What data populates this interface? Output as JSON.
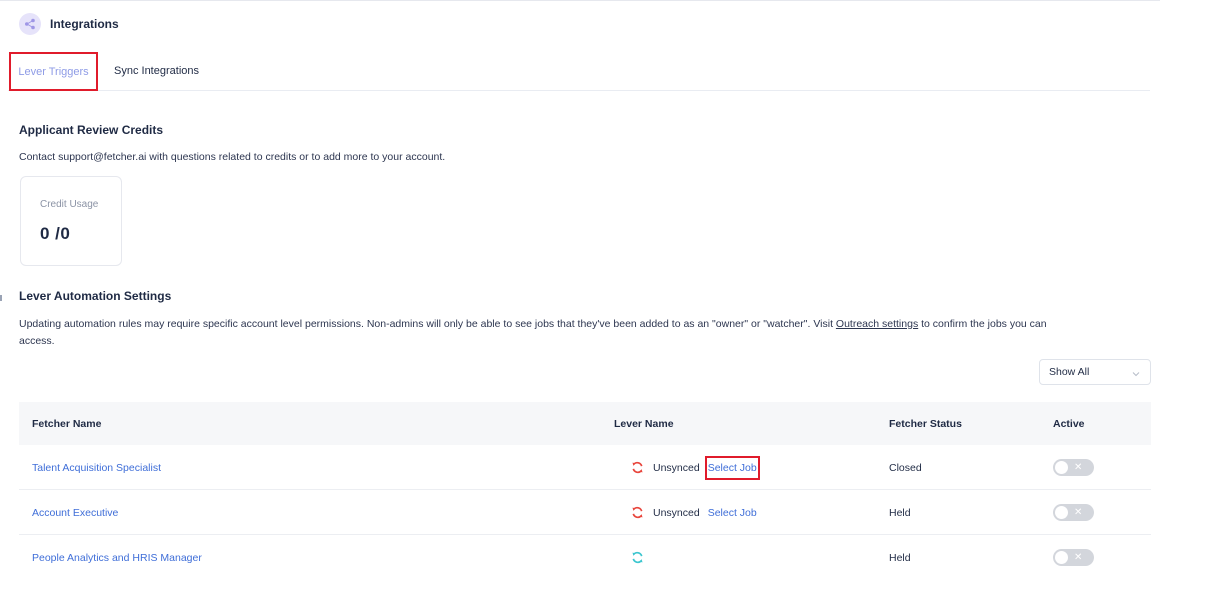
{
  "header": {
    "title": "Integrations",
    "icon": "share-icon"
  },
  "tabs": [
    {
      "label": "Lever Triggers",
      "active": true
    },
    {
      "label": "Sync Integrations",
      "active": false
    }
  ],
  "credits": {
    "title": "Applicant Review Credits",
    "description": "Contact support@fetcher.ai with questions related to credits or to add more to your account.",
    "card_label": "Credit Usage",
    "card_value": "0 /0"
  },
  "automation": {
    "title": "Lever Automation Settings",
    "description_line1_prefix": "Updating automation rules may require specific account level permissions. Non-admins will only be able to see jobs that they've been added to as an \"owner\" or \"watcher\". Visit ",
    "description_link": "Outreach settings",
    "description_line1_suffix": " to confirm the jobs you can",
    "description_line2": "access."
  },
  "filter": {
    "selected": "Show All"
  },
  "table": {
    "headers": {
      "fetcher_name": "Fetcher Name",
      "lever_name": "Lever Name",
      "fetcher_status": "Fetcher Status",
      "active": "Active"
    },
    "rows": [
      {
        "fetcher_name": "Talent Acquisition Specialist",
        "sync_state": "Unsynced",
        "action": "Select Job",
        "status": "Closed",
        "active": false
      },
      {
        "fetcher_name": "Account Executive",
        "sync_state": "Unsynced",
        "action": "Select Job",
        "status": "Held",
        "active": false
      },
      {
        "fetcher_name": "People Analytics and HRIS Manager",
        "sync_state": "",
        "action": "",
        "status": "Held",
        "active": false
      }
    ]
  },
  "colors": {
    "accent": "#3f6ed8",
    "highlight": "#e01b2b",
    "unsynced_icon": "#e8453c",
    "synced_icon": "#3cc6cf"
  }
}
